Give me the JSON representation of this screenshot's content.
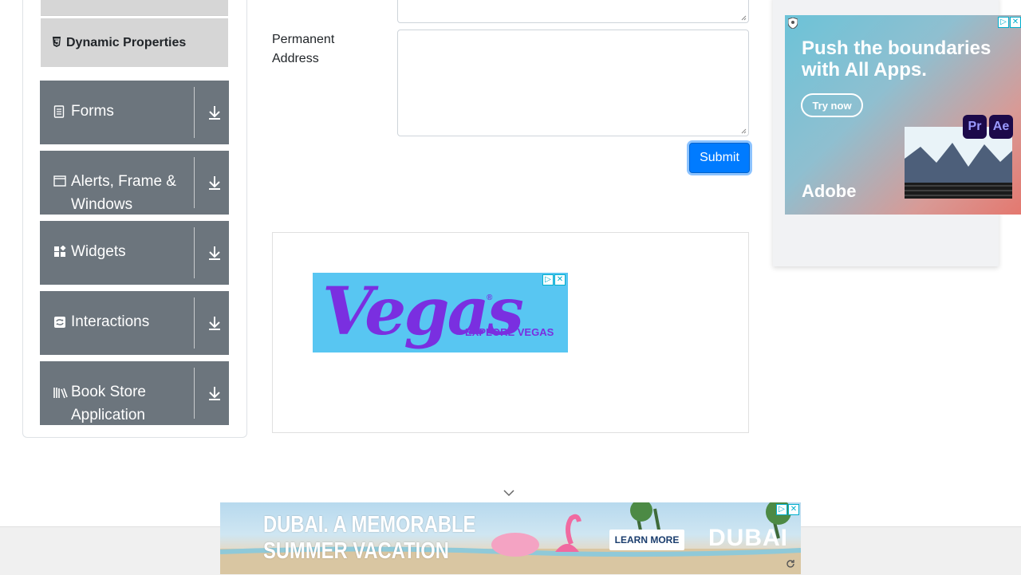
{
  "sidebar": {
    "dynamic_properties": "Dynamic Properties",
    "groups": [
      {
        "label": "Forms",
        "icon": "document-icon"
      },
      {
        "label": "Alerts, Frame & Windows",
        "icon": "window-icon"
      },
      {
        "label": "Widgets",
        "icon": "widgets-icon"
      },
      {
        "label": "Interactions",
        "icon": "interactions-icon"
      },
      {
        "label": "Book Store Application",
        "icon": "books-icon"
      }
    ]
  },
  "form": {
    "permanent_address_label": "Permanent\nAddress",
    "submit_label": "Submit"
  },
  "ads": {
    "vegas": {
      "logo": "Vegas",
      "reg": "®",
      "cta": "EXPLORE VEGAS"
    },
    "adobe": {
      "headline": "Push the boundaries with All Apps.",
      "cta": "Try now",
      "brand": "Adobe",
      "tile_pr": "Pr",
      "tile_ae": "Ae"
    },
    "dubai": {
      "headline_1": "DUBAI. A MEMORABLE",
      "headline_2": "SUMMER VACATION",
      "cta": "LEARN MORE",
      "logo": "DUBAI"
    }
  },
  "colors": {
    "accent": "#007bff",
    "group_bg": "#6c757d",
    "sub_bg": "#d6d6d6"
  }
}
